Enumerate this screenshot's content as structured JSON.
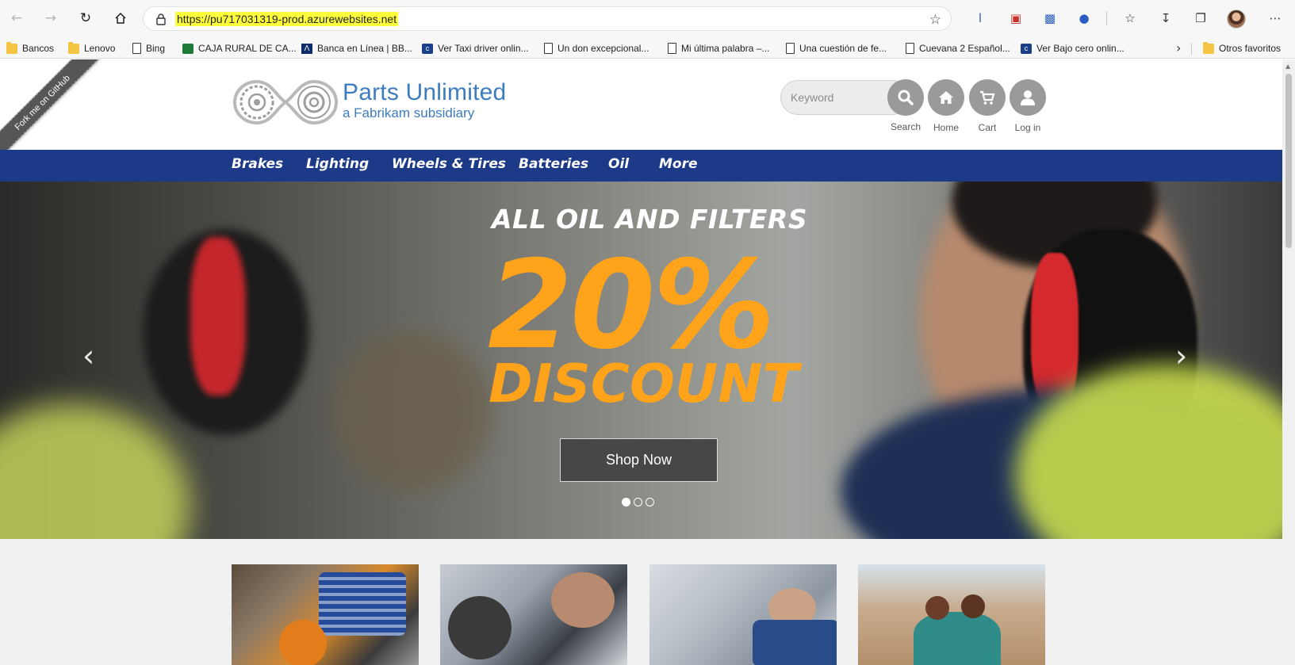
{
  "browser": {
    "url": "https://pu717031319-prod.azurewebsites.net",
    "bookmarks": [
      {
        "label": "Bancos",
        "icon": "folder-icon"
      },
      {
        "label": "Lenovo",
        "icon": "folder-icon"
      },
      {
        "label": "Bing",
        "icon": "page-icon"
      },
      {
        "label": "CAJA RURAL DE CA...",
        "icon": "bank-icon"
      },
      {
        "label": "Banca en Línea | BB...",
        "icon": "bank-icon"
      },
      {
        "label": "Ver Taxi driver onlin...",
        "icon": "site-icon"
      },
      {
        "label": "Un don excepcional...",
        "icon": "page-icon"
      },
      {
        "label": "Mi última palabra –...",
        "icon": "page-icon"
      },
      {
        "label": "Una cuestión de fe...",
        "icon": "page-icon"
      },
      {
        "label": "Cuevana 2 Español...",
        "icon": "page-icon"
      },
      {
        "label": "Ver Bajo cero onlin...",
        "icon": "site-icon"
      }
    ],
    "other_favorites": "Otros favoritos"
  },
  "site": {
    "ribbon": "Fork me on GitHub",
    "brand_title": "Parts Unlimited",
    "brand_subtitle": "a Fabrikam subsidiary",
    "search_placeholder": "Keyword",
    "header_actions": {
      "search": "Search",
      "home": "Home",
      "cart": "Cart",
      "login": "Log in"
    },
    "categories": [
      "Brakes",
      "Lighting",
      "Wheels & Tires",
      "Batteries",
      "Oil",
      "More"
    ]
  },
  "hero": {
    "headline": "ALL OIL AND FILTERS",
    "percent": "20%",
    "discount": "DISCOUNT",
    "cta": "Shop Now",
    "slides": 3,
    "active_slide": 1
  },
  "colors": {
    "nav_bar": "#1c3a87",
    "brand_blue": "#3d7cbe",
    "promo_orange": "#ffa31a",
    "url_highlight": "#ffff3c"
  }
}
